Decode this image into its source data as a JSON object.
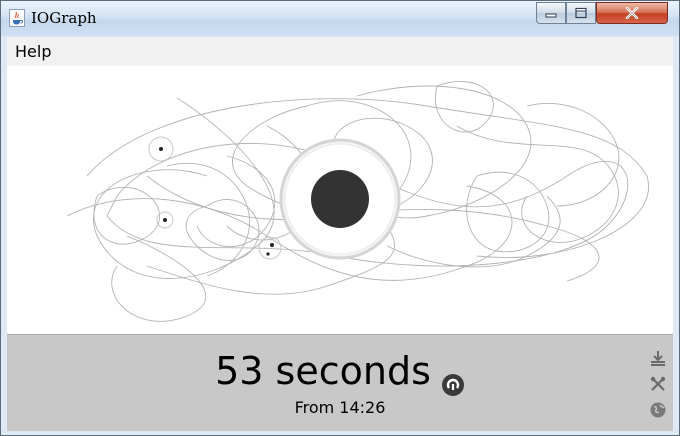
{
  "window": {
    "title": "IOGraph"
  },
  "menu": {
    "items": [
      {
        "label": "Help"
      }
    ]
  },
  "status": {
    "duration": "53 seconds",
    "start": "From 14:26"
  },
  "icons": {
    "app": "java-cup-icon",
    "minimize": "minimize-icon",
    "maximize": "maximize-icon",
    "close": "close-icon",
    "restart": "restart-icon",
    "save": "save-icon",
    "settings": "tools-icon",
    "web": "globe-icon"
  },
  "colors": {
    "track": "#b0b0b0",
    "dot": "#222222",
    "cursor": "#333333",
    "panel": "#c8c8c8"
  }
}
